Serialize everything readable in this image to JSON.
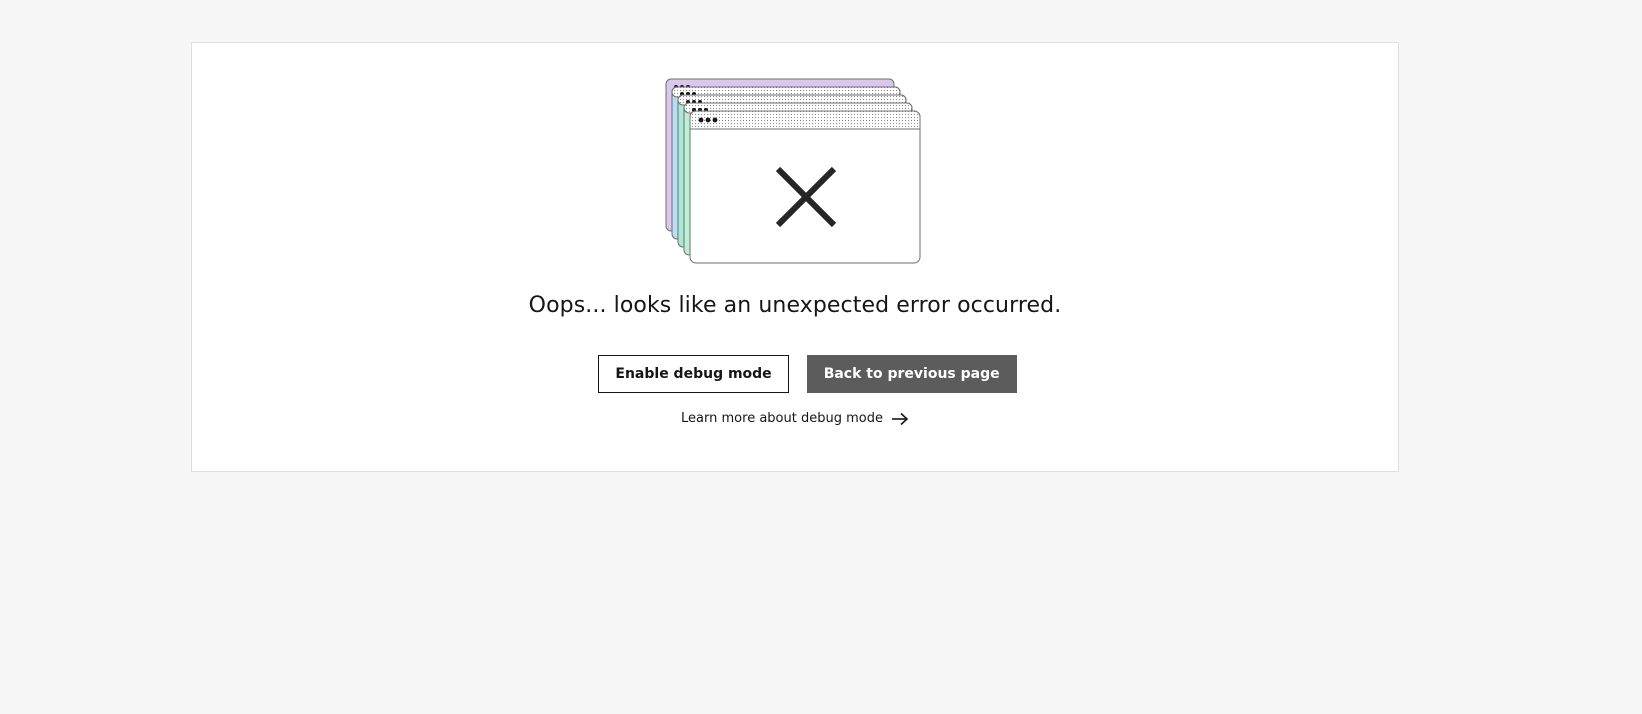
{
  "error": {
    "message": "Oops... looks like an unexpected error occurred.",
    "illustration_icon": "error-windows-icon",
    "colors": {
      "window_purple": "#d9c8ec",
      "window_blue": "#b7def4",
      "window_teal": "#a8ead9",
      "window_green": "#bdf0d2",
      "window_front": "#ffffff",
      "x_mark": "#161616"
    }
  },
  "actions": {
    "enable_debug_label": "Enable debug mode",
    "back_label": "Back to previous page"
  },
  "learn_more": {
    "label": "Learn more about debug mode",
    "icon": "arrow-right-icon"
  }
}
